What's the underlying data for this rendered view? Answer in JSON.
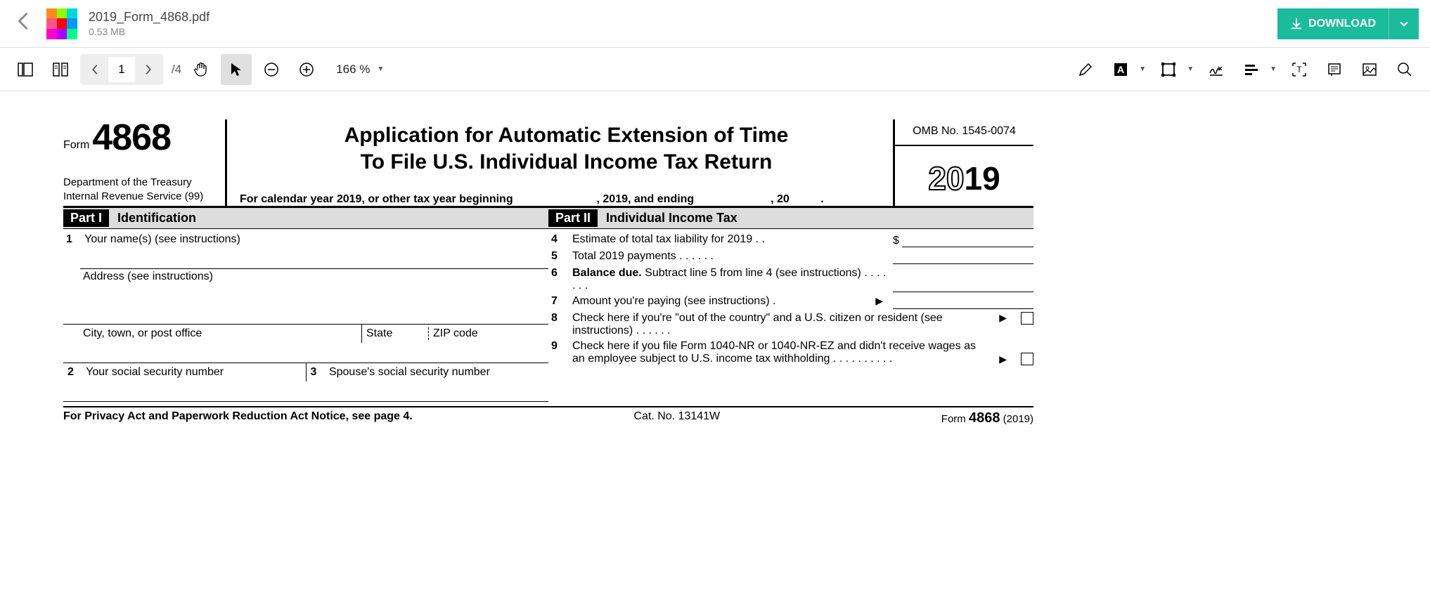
{
  "header": {
    "file_name": "2019_Form_4868.pdf",
    "file_size": "0.53 MB",
    "download_label": "DOWNLOAD"
  },
  "toolbar": {
    "current_page": "1",
    "total_pages": "/4",
    "zoom_label": "166 %"
  },
  "form": {
    "form_word": "Form",
    "form_number": "4868",
    "dept_line1": "Department of the Treasury",
    "dept_line2": "Internal Revenue Service (99)",
    "title_line1": "Application for Automatic Extension of Time",
    "title_line2": "To File U.S. Individual Income Tax Return",
    "calendar_prefix": "For calendar year 2019, or other tax year beginning",
    "calendar_mid": ", 2019, and ending",
    "calendar_suffix": ", 20",
    "omb": "OMB No. 1545-0074",
    "year_outline": "20",
    "year_bold": "19",
    "part1_badge": "Part I",
    "part1_title": "Identification",
    "part2_badge": "Part II",
    "part2_title": "Individual Income Tax",
    "line1_num": "1",
    "line1_text": "Your name(s) (see instructions)",
    "addr_label": "Address (see instructions)",
    "city_label": "City, town, or post office",
    "state_label": "State",
    "zip_label": "ZIP code",
    "line2_num": "2",
    "line2_text": "Your social security number",
    "line3_num": "3",
    "line3_text": "Spouse's social security number",
    "line4_num": "4",
    "line4_text": "Estimate of total tax liability for 2019 .   .",
    "line5_num": "5",
    "line5_text": "Total 2019 payments    .    .    .    .    .    .",
    "line6_num": "6",
    "line6_bold": "Balance due.",
    "line6_rest": " Subtract line 5 from line 4 (see instructions)    .    .    .    .    .    .    .",
    "line7_num": "7",
    "line7_text": "Amount you're paying (see instructions) .",
    "line8_num": "8",
    "line8_text": "Check here if you're \"out of the country\" and a U.S. citizen or resident (see instructions)   .    .    .    .    .    .",
    "line9_num": "9",
    "line9_text": "Check here if you file Form 1040-NR or 1040-NR-EZ and didn't receive wages as an employee subject to U.S. income tax withholding .    .    .    .    .    .    .    .    .    .",
    "dollar": "$",
    "arrow": "▶",
    "footer_left": "For Privacy Act and Paperwork Reduction Act Notice, see page 4.",
    "footer_mid": "Cat. No. 13141W",
    "footer_form_word": "Form ",
    "footer_form_num": "4868",
    "footer_form_year": " (2019)"
  }
}
